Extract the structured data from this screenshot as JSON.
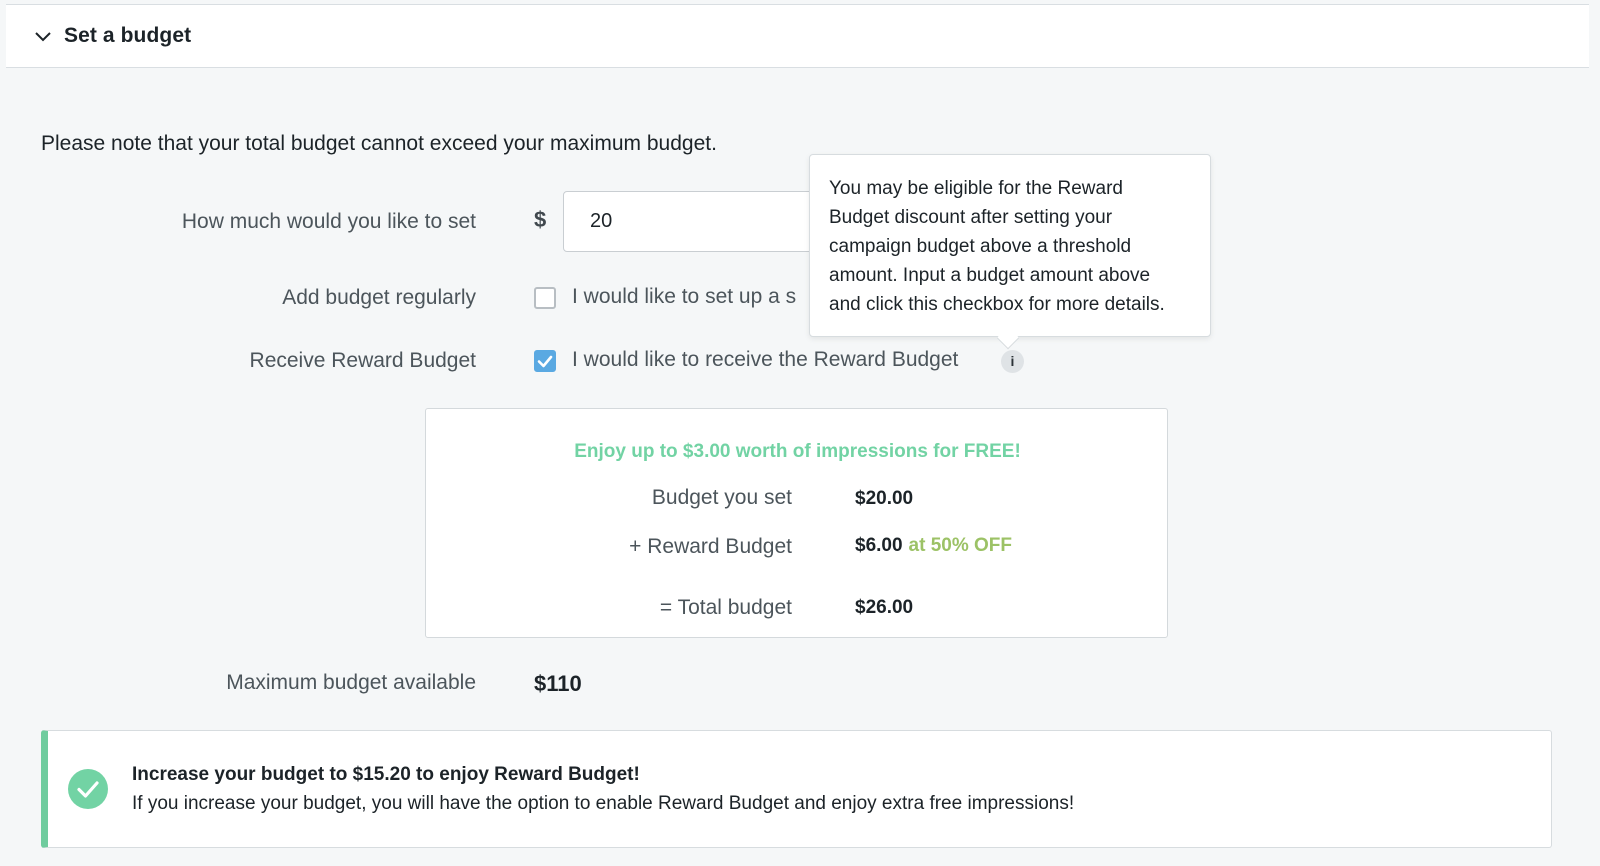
{
  "section": {
    "title": "Set a budget",
    "toggle_icon": "chevron-down-icon"
  },
  "note": "Please note that your total budget cannot exceed your maximum budget.",
  "form": {
    "amount_label": "How much would you like to set",
    "currency_symbol": "$",
    "amount_value": "20",
    "recurring_label": "Add budget regularly",
    "recurring_checkbox_text": "I would like to set up a s",
    "recurring_checked": false,
    "reward_label": "Receive Reward Budget",
    "reward_checkbox_text": "I would like to receive the Reward Budget",
    "reward_checked": true,
    "info_icon": "i"
  },
  "tooltip": {
    "lines": [
      "You may be eligible for the Reward",
      "Budget discount after setting your",
      "campaign budget above a threshold",
      "amount. Input a budget amount above",
      "and click this checkbox for more details."
    ]
  },
  "reward_summary": {
    "promo": "Enjoy up to $3.00 worth of impressions for FREE!",
    "budget_label": "Budget you set",
    "budget_value": "$20.00",
    "reward_label": "+ Reward Budget",
    "reward_value": "$6.00",
    "reward_discount": "at 50% OFF",
    "total_label": "= Total budget",
    "total_value": "$26.00"
  },
  "max_budget": {
    "label": "Maximum budget available",
    "value": "$110"
  },
  "alert": {
    "icon": "check-circle-icon",
    "title": "Increase your budget to $15.20 to enjoy Reward Budget!",
    "body": "If you increase your budget, you will have the option to enable Reward Budget and enjoy extra free impressions!"
  },
  "colors": {
    "accent_blue": "#5aa9e2",
    "promo_green": "#72d3a4",
    "discount_green": "#9cc266",
    "alert_border": "#6fcc9e"
  }
}
